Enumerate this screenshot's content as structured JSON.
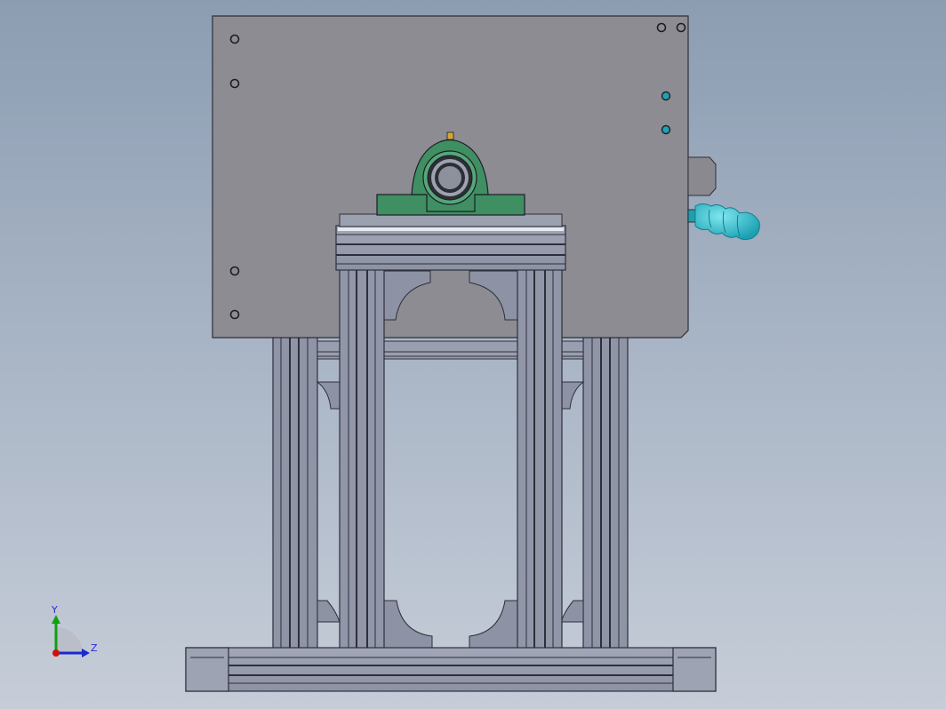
{
  "colors": {
    "background_top": "#8c9db2",
    "background_bottom": "#c6cdd8",
    "plate": "#8d8c92",
    "frame": "#9196a8",
    "frame_dark": "#2d2f3a",
    "bearing_housing": "#3f8f63",
    "handle": "#26b8c8",
    "axis_x": "#d01010",
    "axis_y": "#10a010",
    "axis_z": "#1a2ad0"
  },
  "triad": {
    "y_label": "Y",
    "z_label": "Z"
  }
}
